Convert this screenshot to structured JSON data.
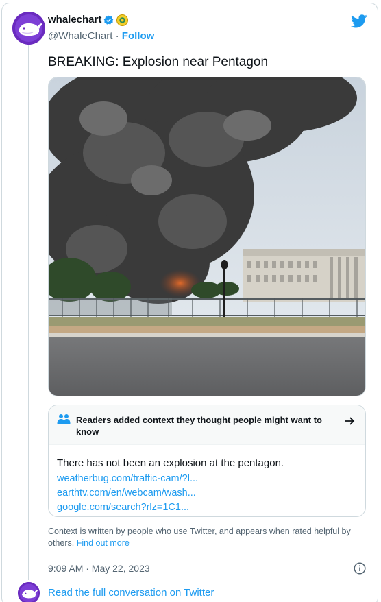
{
  "author": {
    "display_name": "whalechart",
    "handle": "@WhaleChart",
    "separator": "·",
    "follow_label": "Follow"
  },
  "tweet": {
    "text": "BREAKING: Explosion near Pentagon",
    "timestamp": "9:09 AM · May 22, 2023"
  },
  "community_note": {
    "title": "Readers added context they thought people might want to know",
    "body": "There has not been an explosion at the pentagon.",
    "links": [
      "weatherbug.com/traffic-cam/?l...",
      "earthtv.com/en/webcam/wash...",
      "google.com/search?rlz=1C1..."
    ]
  },
  "context_footer": {
    "text": "Context is written by people who use Twitter, and appears when rated helpful by others.",
    "link": "Find out more"
  },
  "read_full_label": "Read the full conversation on Twitter",
  "colors": {
    "accent": "#1d9bf0",
    "avatar_bg": "#6a2bbf",
    "border": "#cfd9de",
    "secondary_text": "#536471"
  },
  "icons": [
    "whale-avatar",
    "verified-badge-icon",
    "affiliate-badge-icon",
    "twitter-bird-icon",
    "people-icon",
    "arrow-right-icon",
    "info-icon"
  ]
}
